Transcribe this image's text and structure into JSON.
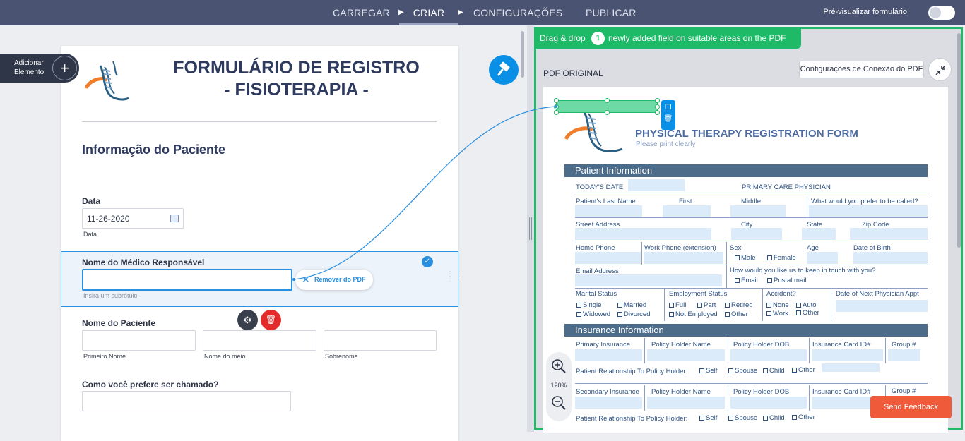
{
  "topbar": {
    "tabs": [
      {
        "label": "CARREGAR"
      },
      {
        "label": "CRIAR"
      },
      {
        "label": "CONFIGURAÇÕES"
      },
      {
        "label": "PUBLICAR"
      }
    ],
    "preview_label": "Pré-visualizar formulário",
    "preview_enabled": false
  },
  "builder": {
    "add_element_line1": "Adicionar",
    "add_element_line2": "Elemento",
    "add_element_icon": "plus-icon",
    "paint_icon": "paint-roller-icon"
  },
  "form": {
    "title_line1": "FORMULÁRIO DE REGISTRO",
    "title_line2": "- FISIOTERAPIA -",
    "section_heading": "Informação do Paciente",
    "date": {
      "label": "Data",
      "value": "11-26-2020",
      "sublabel": "Data"
    },
    "doctor": {
      "label": "Nome do Médico Responsável",
      "value": "",
      "sublabel": "Insira um subrótulo",
      "remove_pdf_label": "Remover do PDF"
    },
    "patient_name": {
      "label": "Nome do Paciente",
      "first": "Primeiro Nome",
      "middle": "Nome do meio",
      "last": "Sobrenome"
    },
    "preferred_name": {
      "label": "Como você prefere ser chamado?",
      "value": ""
    }
  },
  "pdf_panel": {
    "banner_before": "Drag & drop",
    "banner_count": "1",
    "banner_after": "newly added field on suitable areas on the PDF",
    "original_label": "PDF ORIGINAL",
    "connection_settings": "Configurações de Conexão do PDF",
    "zoom_level": "120%",
    "feedback_label": "Send Feedback",
    "accent_color": "#1fba68"
  },
  "pdf": {
    "title": "PHYSICAL THERAPY REGISTRATION FORM",
    "subtitle": "Please print clearly",
    "patient_section": "Patient Information",
    "todays_date": "TODAY'S DATE",
    "primary_physician": "PRIMARY CARE PHYSICIAN",
    "last_name": "Patient's Last Name",
    "first": "First",
    "middle": "Middle",
    "called": "What would you prefer to be called?",
    "street": "Street Address",
    "city": "City",
    "state": "State",
    "zip": "Zip Code",
    "home_phone": "Home Phone",
    "work_phone": "Work Phone (extension)",
    "sex": "Sex",
    "male": "Male",
    "female": "Female",
    "age": "Age",
    "dob": "Date of Birth",
    "email": "Email Address",
    "keep_touch": "How would you like us to keep in touch with you?",
    "email_opt": "Email",
    "postal_opt": "Postal mail",
    "marital": "Marital Status",
    "single": "Single",
    "married": "Married",
    "widowed": "Widowed",
    "divorced": "Divorced",
    "employment": "Employment Status",
    "full": "Full",
    "part": "Part",
    "retired": "Retired",
    "not_employed": "Not Employed",
    "other": "Other",
    "accident": "Accident?",
    "none": "None",
    "auto": "Auto",
    "work": "Work",
    "next_appt": "Date of Next Physician Appt",
    "insurance_section": "Insurance Information",
    "primary_ins": "Primary Insurance",
    "holder_name": "Policy Holder Name",
    "holder_dob": "Policy Holder DOB",
    "card_id": "Insurance Card ID#",
    "group": "Group #",
    "relationship": "Patient Relationship To Policy Holder:",
    "self": "Self",
    "spouse": "Spouse",
    "child": "Child",
    "secondary_ins": "Secondary Insurance"
  }
}
